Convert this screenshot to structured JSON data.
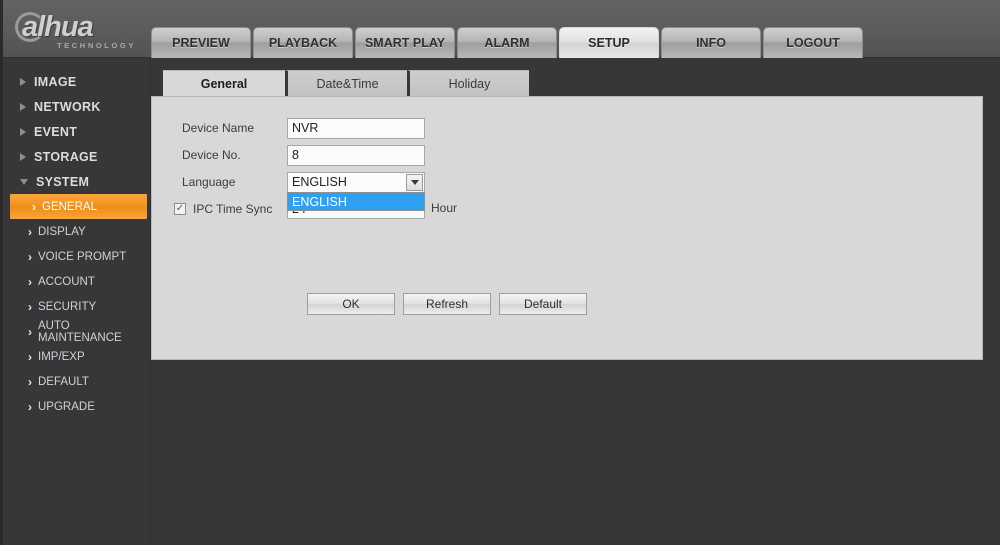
{
  "header": {
    "logo_text": "alhua",
    "logo_sub": "TECHNOLOGY",
    "nav": [
      {
        "label": "PREVIEW",
        "active": false
      },
      {
        "label": "PLAYBACK",
        "active": false
      },
      {
        "label": "SMART PLAY",
        "active": false
      },
      {
        "label": "ALARM",
        "active": false
      },
      {
        "label": "SETUP",
        "active": true
      },
      {
        "label": "INFO",
        "active": false
      },
      {
        "label": "LOGOUT",
        "active": false
      }
    ]
  },
  "sidebar": {
    "groups": [
      {
        "label": "IMAGE",
        "expanded": false
      },
      {
        "label": "NETWORK",
        "expanded": false
      },
      {
        "label": "EVENT",
        "expanded": false
      },
      {
        "label": "STORAGE",
        "expanded": false
      },
      {
        "label": "SYSTEM",
        "expanded": true
      }
    ],
    "system_items": [
      {
        "label": "GENERAL",
        "active": true
      },
      {
        "label": "DISPLAY",
        "active": false
      },
      {
        "label": "VOICE PROMPT",
        "active": false
      },
      {
        "label": "ACCOUNT",
        "active": false
      },
      {
        "label": "SECURITY",
        "active": false
      },
      {
        "label": "AUTO MAINTENANCE",
        "active": false
      },
      {
        "label": "IMP/EXP",
        "active": false
      },
      {
        "label": "DEFAULT",
        "active": false
      },
      {
        "label": "UPGRADE",
        "active": false
      }
    ]
  },
  "content": {
    "tabs": [
      {
        "label": "General",
        "active": true
      },
      {
        "label": "Date&Time",
        "active": false
      },
      {
        "label": "Holiday",
        "active": false
      }
    ],
    "form": {
      "device_name_label": "Device Name",
      "device_name_value": "NVR",
      "device_no_label": "Device No.",
      "device_no_value": "8",
      "language_label": "Language",
      "language_value": "ENGLISH",
      "language_options": [
        "ENGLISH"
      ],
      "ipc_time_sync_label": "IPC Time Sync",
      "ipc_time_sync_checked": true,
      "ipc_time_sync_check_glyph": "✓",
      "ipc_time_sync_value": "24",
      "hour_label": "Hour"
    },
    "buttons": [
      {
        "label": "OK"
      },
      {
        "label": "Refresh"
      },
      {
        "label": "Default"
      }
    ]
  },
  "colors": {
    "accent_orange": "#f2921c",
    "dropdown_highlight": "#2f9ff2",
    "panel_bg": "#d8d8d8",
    "page_bg": "#37373a"
  }
}
